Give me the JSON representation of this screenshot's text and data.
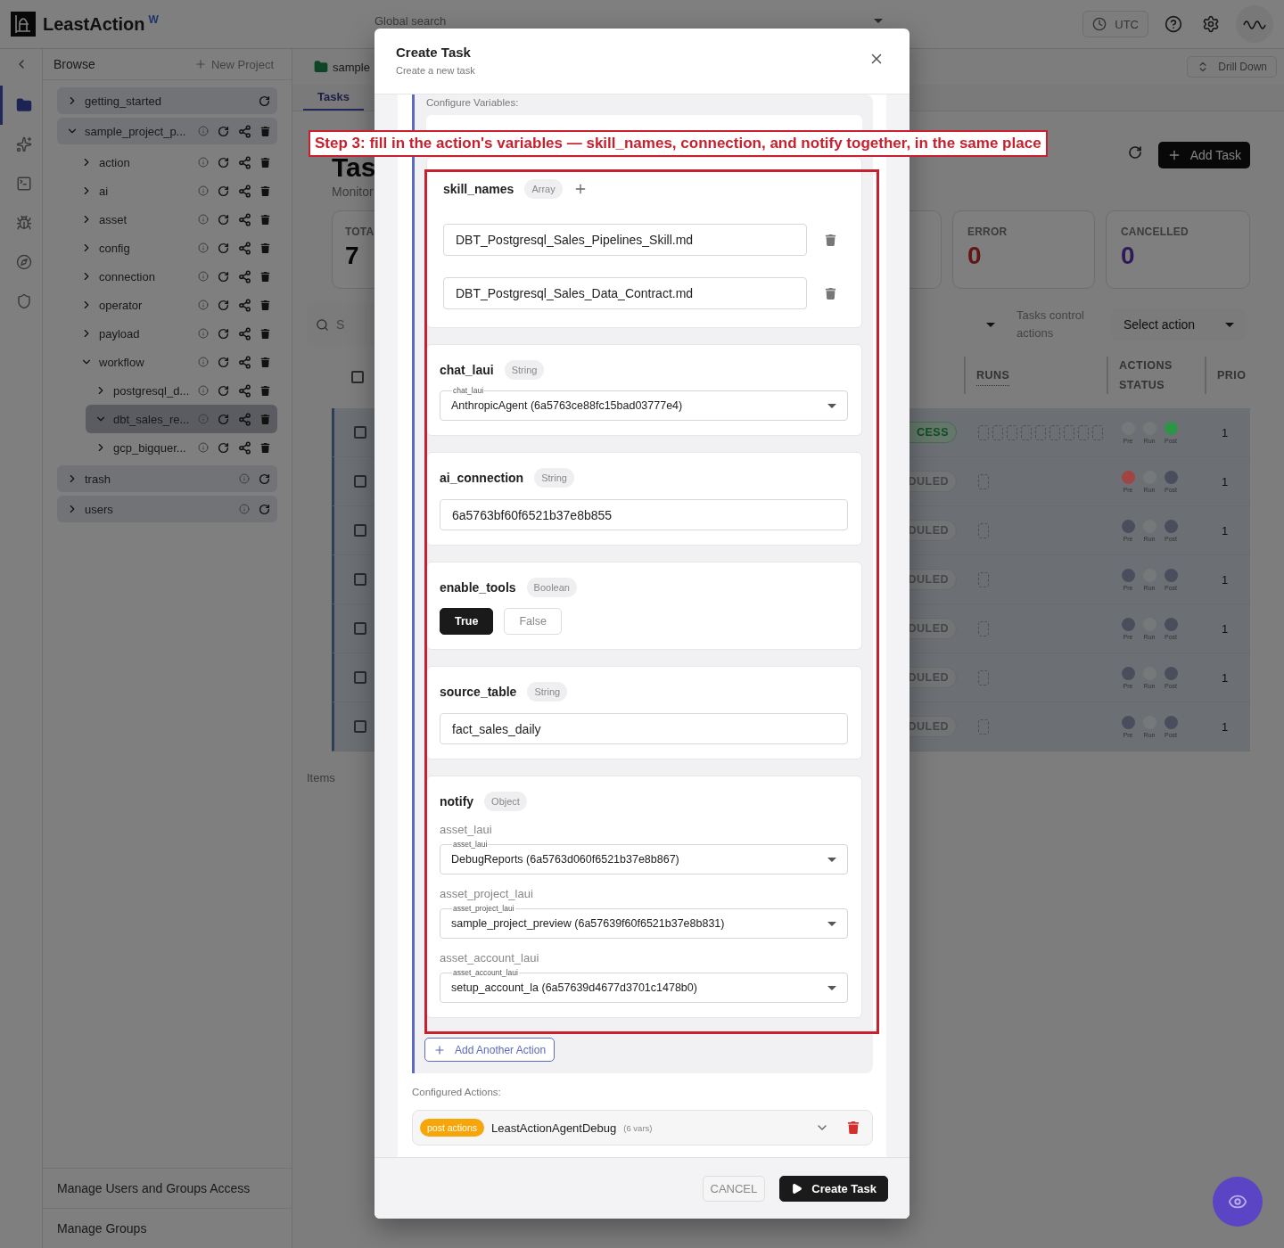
{
  "app": {
    "name": "LeastAction",
    "badge": "W"
  },
  "top_bar": {
    "search": {
      "placeholder": "Global search"
    },
    "timezone": "UTC"
  },
  "nav_rail": [
    {
      "selected": true
    },
    {
      "selected": false
    },
    {
      "selected": false
    },
    {
      "selected": false
    },
    {
      "selected": false
    },
    {
      "selected": false
    }
  ],
  "sidebar": {
    "title": "Browse",
    "new_project": "New Project",
    "tree": [
      {
        "name": "getting_started",
        "kind": "starter",
        "expanded": false,
        "selected": false
      },
      {
        "name": "sample_project_p...",
        "kind": "editable",
        "expanded": true,
        "selected": false,
        "children": [
          {
            "name": "action",
            "kind": "editable",
            "expanded": false,
            "selected": false
          },
          {
            "name": "ai",
            "kind": "editable",
            "expanded": false,
            "selected": false
          },
          {
            "name": "asset",
            "kind": "editable",
            "expanded": false,
            "selected": false
          },
          {
            "name": "config",
            "kind": "editable",
            "expanded": false,
            "selected": false
          },
          {
            "name": "connection",
            "kind": "editable",
            "expanded": false,
            "selected": false
          },
          {
            "name": "operator",
            "kind": "editable",
            "expanded": false,
            "selected": false
          },
          {
            "name": "payload",
            "kind": "editable",
            "expanded": false,
            "selected": false
          },
          {
            "name": "workflow",
            "kind": "editable",
            "expanded": true,
            "selected": false,
            "children": [
              {
                "name": "postgresql_d...",
                "kind": "editable",
                "expanded": false,
                "selected": false
              },
              {
                "name": "dbt_sales_re...",
                "kind": "editable",
                "expanded": true,
                "selected": true
              },
              {
                "name": "gcp_bigquer...",
                "kind": "editable",
                "expanded": false,
                "selected": false
              }
            ]
          }
        ]
      },
      {
        "name": "trash",
        "kind": "system",
        "expanded": false,
        "selected": false
      },
      {
        "name": "users",
        "kind": "system",
        "expanded": false,
        "selected": false
      }
    ],
    "footer_links": [
      "Manage Users and Groups Access",
      "Manage Groups"
    ]
  },
  "main": {
    "breadcrumb": "sample",
    "drill_down": "Drill Down",
    "tabs": [
      {
        "label": "Tasks",
        "selected": true
      }
    ],
    "title": "Tas",
    "subtitle": "Monitor",
    "add_task": "Add Task",
    "stats": [
      {
        "label": "TOTA",
        "value": "7",
        "kind": "total"
      },
      {
        "label": "ERROR",
        "value": "0",
        "kind": "error"
      },
      {
        "label": "CANCELLED",
        "value": "0",
        "kind": "cancelled"
      }
    ],
    "search": {
      "placeholder": "S"
    },
    "control_label": "Tasks control actions",
    "action_select": "Select action",
    "table": {
      "header_checked": false,
      "columns": [
        "RUNS",
        "ACTIONS STATUS",
        "PRIO"
      ],
      "rows": [
        {
          "checked": false,
          "status": {
            "text": "CESS",
            "kind": "success"
          },
          "runs": {
            "kind": "history"
          },
          "stages": [
            {
              "label": "Pre",
              "color": "#777879"
            },
            {
              "label": "Run",
              "color": "#777879"
            },
            {
              "label": "Post",
              "color": "#2e9446"
            }
          ],
          "priority": "1"
        },
        {
          "checked": false,
          "status": {
            "text": "DULED",
            "kind": "scheduled"
          },
          "runs": {
            "kind": "single"
          },
          "stages": [
            {
              "label": "Pre",
              "color": "#a04444"
            },
            {
              "label": "Run",
              "color": "#777879"
            },
            {
              "label": "Post",
              "color": "#4a4e5c"
            }
          ],
          "priority": "1"
        },
        {
          "checked": false,
          "status": {
            "text": "DULED",
            "kind": "scheduled"
          },
          "runs": {
            "kind": "single"
          },
          "stages": [
            {
              "label": "Pre",
              "color": "#4a4e5c"
            },
            {
              "label": "Run",
              "color": "#777879"
            },
            {
              "label": "Post",
              "color": "#4a4e5c"
            }
          ],
          "priority": "1"
        },
        {
          "checked": false,
          "status": {
            "text": "DULED",
            "kind": "scheduled"
          },
          "runs": {
            "kind": "single"
          },
          "stages": [
            {
              "label": "Pre",
              "color": "#4a4e5c"
            },
            {
              "label": "Run",
              "color": "#777879"
            },
            {
              "label": "Post",
              "color": "#4a4e5c"
            }
          ],
          "priority": "1"
        },
        {
          "checked": false,
          "status": {
            "text": "DULED",
            "kind": "scheduled"
          },
          "runs": {
            "kind": "single"
          },
          "stages": [
            {
              "label": "Pre",
              "color": "#4a4e5c"
            },
            {
              "label": "Run",
              "color": "#777879"
            },
            {
              "label": "Post",
              "color": "#4a4e5c"
            }
          ],
          "priority": "1"
        },
        {
          "checked": false,
          "status": {
            "text": "DULED",
            "kind": "scheduled"
          },
          "runs": {
            "kind": "single"
          },
          "stages": [
            {
              "label": "Pre",
              "color": "#4a4e5c"
            },
            {
              "label": "Run",
              "color": "#777879"
            },
            {
              "label": "Post",
              "color": "#4a4e5c"
            }
          ],
          "priority": "1"
        },
        {
          "checked": false,
          "status": {
            "text": "DULED",
            "kind": "scheduled"
          },
          "runs": {
            "kind": "single"
          },
          "stages": [
            {
              "label": "Pre",
              "color": "#4a4e5c"
            },
            {
              "label": "Run",
              "color": "#777879"
            },
            {
              "label": "Post",
              "color": "#4a4e5c"
            }
          ],
          "priority": "1"
        }
      ]
    },
    "items_label": "Items"
  },
  "dialog": {
    "title": "Create Task",
    "subtitle": "Create a new task",
    "section_label": "Configure Variables:",
    "variables": [
      {
        "name": "skill_names",
        "type": "Array",
        "kind": "array",
        "items": [
          "DBT_Postgresql_Sales_Pipelines_Skill.md",
          "DBT_Postgresql_Sales_Data_Contract.md"
        ]
      },
      {
        "name": "chat_laui",
        "type": "String",
        "kind": "select",
        "label": "chat_laui",
        "value": "AnthropicAgent (6a5763ce88fc15bad03777e4)"
      },
      {
        "name": "ai_connection",
        "type": "String",
        "kind": "text",
        "value": "6a5763bf60f6521b37e8b855"
      },
      {
        "name": "enable_tools",
        "type": "Boolean",
        "kind": "boolean",
        "options": [
          {
            "label": "True",
            "selected": true
          },
          {
            "label": "False",
            "selected": false
          }
        ]
      },
      {
        "name": "source_table",
        "type": "String",
        "kind": "text",
        "value": "fact_sales_daily"
      },
      {
        "name": "notify",
        "type": "Object",
        "kind": "object",
        "fields": [
          {
            "title": "asset_laui",
            "label": "asset_laui",
            "value": "DebugReports (6a5763d060f6521b37e8b867)"
          },
          {
            "title": "asset_project_laui",
            "label": "asset_project_laui",
            "value": "sample_project_preview (6a57639f60f6521b37e8b831)"
          },
          {
            "title": "asset_account_laui",
            "label": "asset_account_laui",
            "value": "setup_account_la (6a57639d4677d3701c1478b0)"
          }
        ]
      }
    ],
    "add_action": "Add Another Action",
    "configured_label": "Configured Actions:",
    "configured_actions": [
      {
        "badge": "post actions",
        "name": "LeastActionAgentDebug",
        "count": "(6 vars)"
      }
    ],
    "buttons": [
      {
        "label": "CANCEL",
        "kind": "secondary"
      },
      {
        "label": "Create Task",
        "kind": "primary"
      }
    ]
  },
  "annotation": {
    "text": "Step 3: fill in the action's variables — skill_names, connection, and notify together, in the same place"
  }
}
